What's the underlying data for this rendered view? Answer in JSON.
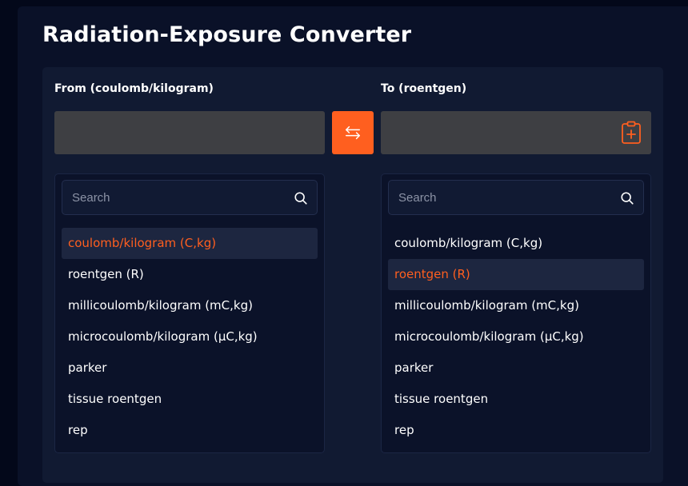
{
  "title": "Radiation-Exposure Converter",
  "accent_color": "#ff5f1f",
  "from": {
    "label": "From (coulomb/kilogram)",
    "value": "",
    "search_placeholder": "Search",
    "selected_index": 0,
    "options": [
      "coulomb/kilogram (C,kg)",
      "roentgen (R)",
      "millicoulomb/kilogram (mC,kg)",
      "microcoulomb/kilogram (µC,kg)",
      "parker",
      "tissue roentgen",
      "rep"
    ]
  },
  "to": {
    "label": "To (roentgen)",
    "value": "",
    "search_placeholder": "Search",
    "selected_index": 1,
    "options": [
      "coulomb/kilogram (C,kg)",
      "roentgen (R)",
      "millicoulomb/kilogram (mC,kg)",
      "microcoulomb/kilogram (µC,kg)",
      "parker",
      "tissue roentgen",
      "rep"
    ]
  },
  "icons": {
    "swap": "swap-arrows-icon",
    "paste": "clipboard-plus-icon",
    "search": "search-icon"
  }
}
